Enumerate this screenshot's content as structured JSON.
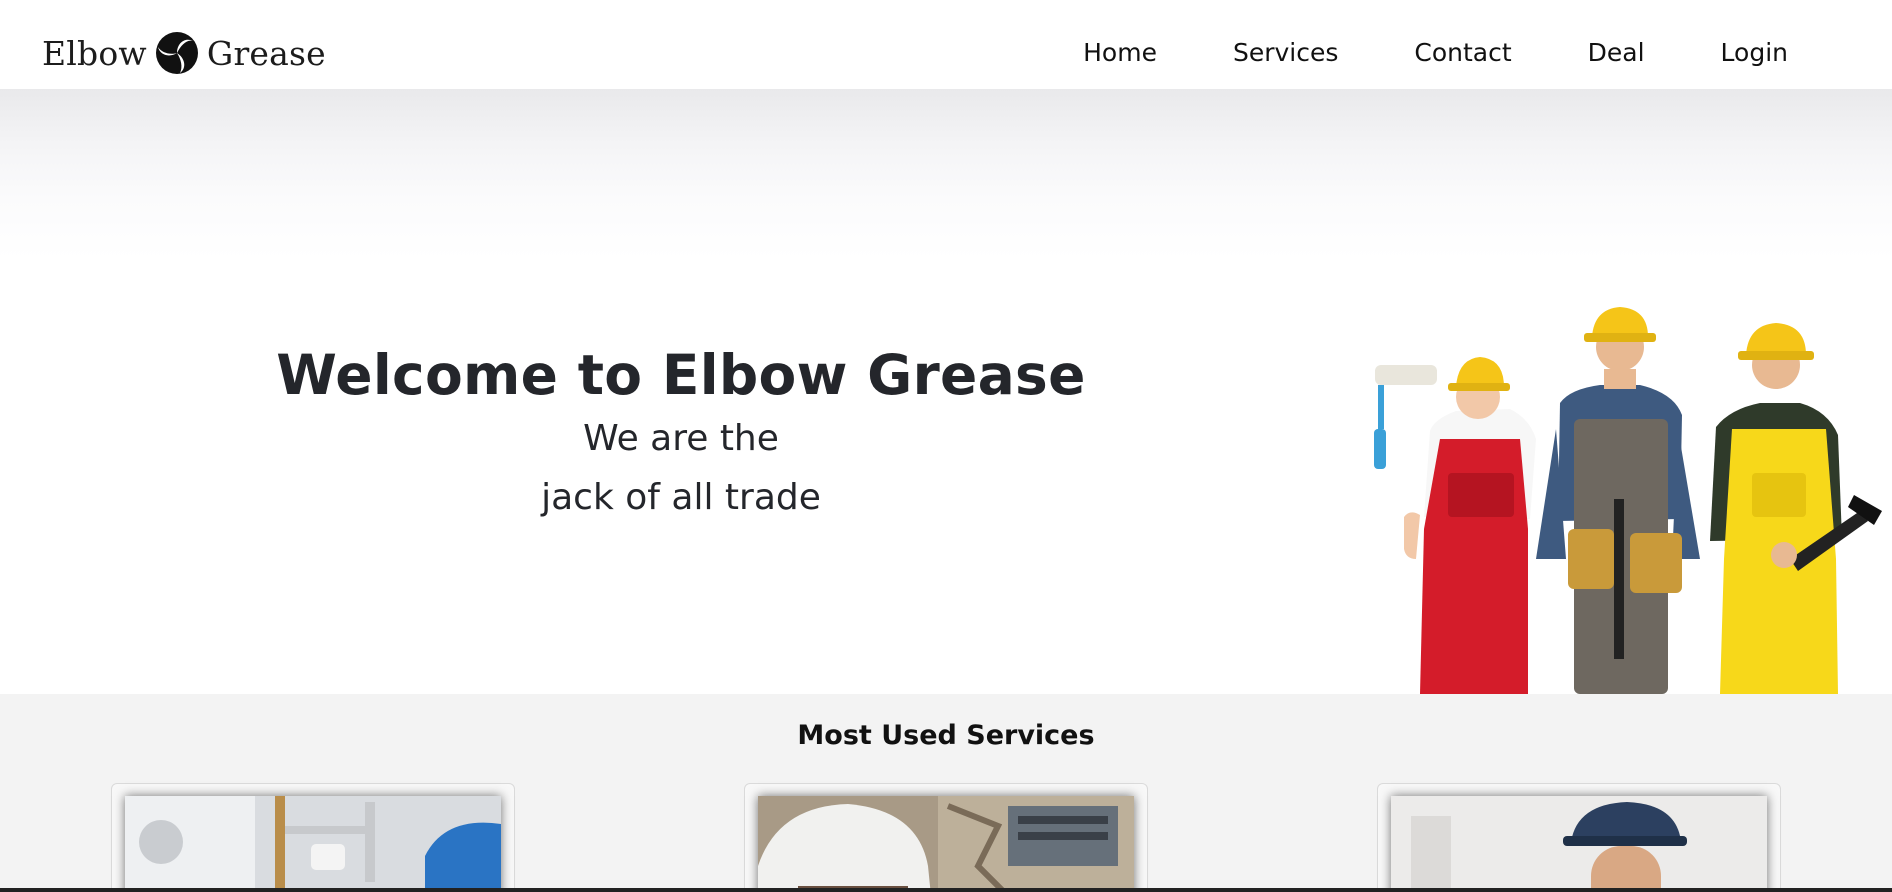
{
  "brand": {
    "name_left": "Elbow",
    "name_right": "Grease",
    "logo_icon": "swirl-logo-icon"
  },
  "nav": {
    "items": [
      {
        "label": "Home"
      },
      {
        "label": "Services"
      },
      {
        "label": "Contact"
      },
      {
        "label": "Deal"
      },
      {
        "label": "Login"
      }
    ]
  },
  "hero": {
    "title": "Welcome to Elbow Grease",
    "subtitle_line1": "We are the",
    "subtitle_line2": "jack of all trade",
    "image": "three-construction-workers-photo"
  },
  "services": {
    "title": "Most Used Services",
    "cards": [
      {
        "image": "plumbing-pipes-photo"
      },
      {
        "image": "electrician-helmet-photo"
      },
      {
        "image": "handyman-cap-photo"
      }
    ]
  },
  "colors": {
    "text_dark": "#24262b",
    "services_bg": "#f3f3f3",
    "helmet_yellow": "#f5c518",
    "overall_red": "#d41c2a",
    "overall_yellow": "#f7d81a"
  }
}
